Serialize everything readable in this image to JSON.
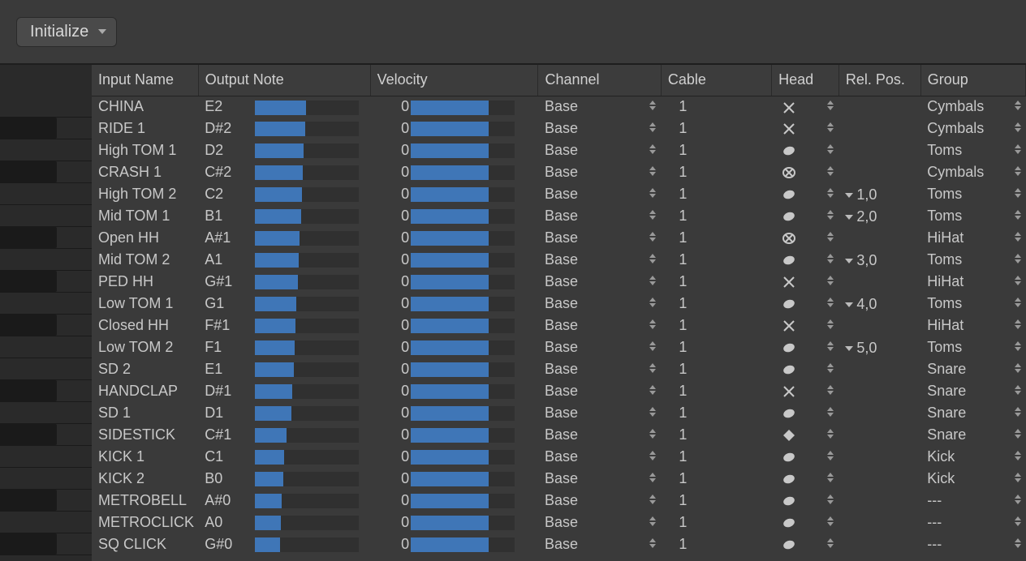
{
  "toolbar": {
    "preset_label": "Initialize"
  },
  "columns": {
    "input": "Input Name",
    "outnote": "Output Note",
    "velocity": "Velocity",
    "channel": "Channel",
    "cable": "Cable",
    "head": "Head",
    "relpos": "Rel. Pos.",
    "group": "Group"
  },
  "rows": [
    {
      "input": "CHINA",
      "note": "E2",
      "noteFill": 49,
      "vel": 0,
      "velFill": 75,
      "channel": "Base",
      "cable": "1",
      "head": "x",
      "relpos": "",
      "group": "Cymbals",
      "isBlack": false
    },
    {
      "input": "RIDE 1",
      "note": "D#2",
      "noteFill": 48,
      "vel": 0,
      "velFill": 75,
      "channel": "Base",
      "cable": "1",
      "head": "x",
      "relpos": "",
      "group": "Cymbals",
      "isBlack": true
    },
    {
      "input": "High TOM 1",
      "note": "D2",
      "noteFill": 47,
      "vel": 0,
      "velFill": 75,
      "channel": "Base",
      "cable": "1",
      "head": "ellipse",
      "relpos": "",
      "group": "Toms",
      "isBlack": false
    },
    {
      "input": "CRASH 1",
      "note": "C#2",
      "noteFill": 46,
      "vel": 0,
      "velFill": 75,
      "channel": "Base",
      "cable": "1",
      "head": "xcircle",
      "relpos": "",
      "group": "Cymbals",
      "isBlack": true
    },
    {
      "input": "High TOM 2",
      "note": "C2",
      "noteFill": 45,
      "vel": 0,
      "velFill": 75,
      "channel": "Base",
      "cable": "1",
      "head": "ellipse",
      "relpos": "1,0",
      "group": "Toms",
      "isBlack": false
    },
    {
      "input": "Mid TOM 1",
      "note": "B1",
      "noteFill": 44,
      "vel": 0,
      "velFill": 75,
      "channel": "Base",
      "cable": "1",
      "head": "ellipse",
      "relpos": "2,0",
      "group": "Toms",
      "isBlack": false
    },
    {
      "input": "Open HH",
      "note": "A#1",
      "noteFill": 43,
      "vel": 0,
      "velFill": 75,
      "channel": "Base",
      "cable": "1",
      "head": "xcircle",
      "relpos": "",
      "group": "HiHat",
      "isBlack": true
    },
    {
      "input": "Mid TOM 2",
      "note": "A1",
      "noteFill": 42,
      "vel": 0,
      "velFill": 75,
      "channel": "Base",
      "cable": "1",
      "head": "ellipse",
      "relpos": "3,0",
      "group": "Toms",
      "isBlack": false
    },
    {
      "input": "PED HH",
      "note": "G#1",
      "noteFill": 41,
      "vel": 0,
      "velFill": 75,
      "channel": "Base",
      "cable": "1",
      "head": "x",
      "relpos": "",
      "group": "HiHat",
      "isBlack": true
    },
    {
      "input": "Low TOM 1",
      "note": "G1",
      "noteFill": 40,
      "vel": 0,
      "velFill": 75,
      "channel": "Base",
      "cable": "1",
      "head": "ellipse",
      "relpos": "4,0",
      "group": "Toms",
      "isBlack": false
    },
    {
      "input": "Closed HH",
      "note": "F#1",
      "noteFill": 39,
      "vel": 0,
      "velFill": 75,
      "channel": "Base",
      "cable": "1",
      "head": "x",
      "relpos": "",
      "group": "HiHat",
      "isBlack": true
    },
    {
      "input": "Low TOM 2",
      "note": "F1",
      "noteFill": 38,
      "vel": 0,
      "velFill": 75,
      "channel": "Base",
      "cable": "1",
      "head": "ellipse",
      "relpos": "5,0",
      "group": "Toms",
      "isBlack": false
    },
    {
      "input": "SD 2",
      "note": "E1",
      "noteFill": 37,
      "vel": 0,
      "velFill": 75,
      "channel": "Base",
      "cable": "1",
      "head": "ellipse",
      "relpos": "",
      "group": "Snare",
      "isBlack": false
    },
    {
      "input": "HANDCLAP",
      "note": "D#1",
      "noteFill": 36,
      "vel": 0,
      "velFill": 75,
      "channel": "Base",
      "cable": "1",
      "head": "x",
      "relpos": "",
      "group": "Snare",
      "isBlack": true
    },
    {
      "input": "SD 1",
      "note": "D1",
      "noteFill": 35,
      "vel": 0,
      "velFill": 75,
      "channel": "Base",
      "cable": "1",
      "head": "ellipse",
      "relpos": "",
      "group": "Snare",
      "isBlack": false
    },
    {
      "input": "SIDESTICK",
      "note": "C#1",
      "noteFill": 30,
      "vel": 0,
      "velFill": 75,
      "channel": "Base",
      "cable": "1",
      "head": "diamond",
      "relpos": "",
      "group": "Snare",
      "isBlack": true
    },
    {
      "input": "KICK 1",
      "note": "C1",
      "noteFill": 28,
      "vel": 0,
      "velFill": 75,
      "channel": "Base",
      "cable": "1",
      "head": "ellipse",
      "relpos": "",
      "group": "Kick",
      "isBlack": false
    },
    {
      "input": "KICK 2",
      "note": "B0",
      "noteFill": 27,
      "vel": 0,
      "velFill": 75,
      "channel": "Base",
      "cable": "1",
      "head": "ellipse",
      "relpos": "",
      "group": "Kick",
      "isBlack": false
    },
    {
      "input": "METROBELL",
      "note": "A#0",
      "noteFill": 26,
      "vel": 0,
      "velFill": 75,
      "channel": "Base",
      "cable": "1",
      "head": "ellipse",
      "relpos": "",
      "group": "---",
      "isBlack": true
    },
    {
      "input": "METROCLICK",
      "note": "A0",
      "noteFill": 25,
      "vel": 0,
      "velFill": 75,
      "channel": "Base",
      "cable": "1",
      "head": "ellipse",
      "relpos": "",
      "group": "---",
      "isBlack": false
    },
    {
      "input": "SQ CLICK",
      "note": "G#0",
      "noteFill": 24,
      "vel": 0,
      "velFill": 75,
      "channel": "Base",
      "cable": "1",
      "head": "ellipse",
      "relpos": "",
      "group": "---",
      "isBlack": true
    }
  ]
}
